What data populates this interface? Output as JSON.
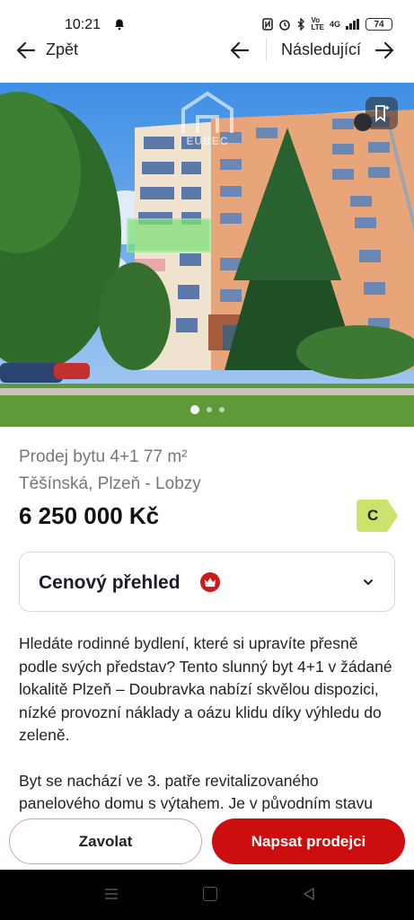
{
  "status_bar": {
    "time": "10:21",
    "battery": "74",
    "network": "4G"
  },
  "nav": {
    "back_label": "Zpět",
    "next_label": "Následující"
  },
  "photo": {
    "watermark_text": "EUBEC",
    "current_index": 1,
    "total_dots": 3
  },
  "listing": {
    "title": "Prodej bytu 4+1 77 m²",
    "address": "Těšínská, Plzeň - Lobzy",
    "price": "6 250 000 Kč",
    "energy_class": "C",
    "energy_color": "#c9e36b"
  },
  "price_overview": {
    "label": "Cenový přehled",
    "accent": "#cc1a1a"
  },
  "description": {
    "paragraphs": [
      "Hledáte rodinné bydlení, které si upravíte přesně podle svých představ? Tento slunný byt 4+1 v žádané lokalitě Plzeň – Doubravka nabízí skvělou dispozici, nízké provozní náklady a oázu klidu díky výhledu do zeleně.",
      "Byt se nachází ve 3. patře revitalizovaného panelového domu s výtahem. Je v původním stavu"
    ]
  },
  "actions": {
    "call_label": "Zavolat",
    "write_label": "Napsat prodejci",
    "primary_color": "#cc0e0e"
  },
  "icons": [
    "back-arrow-icon",
    "prev-arrow-icon",
    "next-arrow-icon",
    "bookmark-icon",
    "crown-icon",
    "chevron-down-icon",
    "bell-icon"
  ]
}
